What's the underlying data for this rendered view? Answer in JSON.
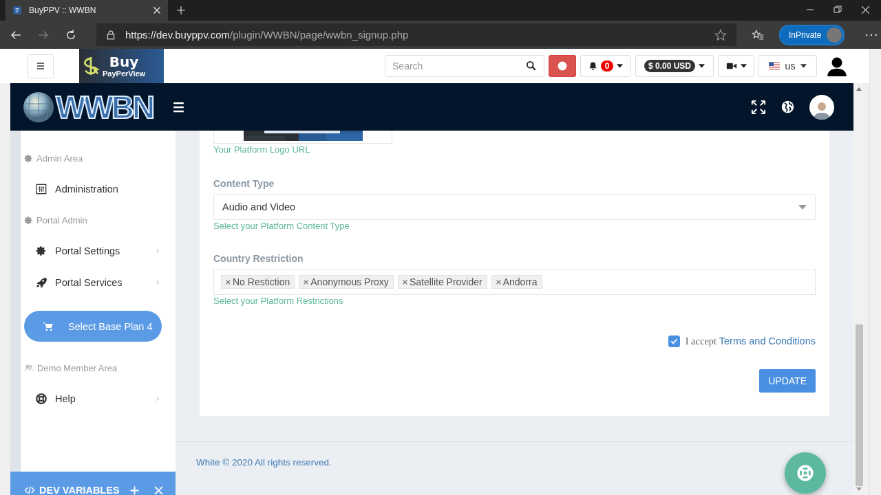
{
  "browser": {
    "tab_title": "BuyPPV :: WWBN",
    "url_host": "https://dev.buyppv.com",
    "url_path": "/plugin/WWBN/page/wwbn_signup.php",
    "profile_label": "InPrivate"
  },
  "header": {
    "logo_lines": [
      "Buy",
      "PayPerView"
    ],
    "search": {
      "placeholder": "Search"
    },
    "notification_count": "0",
    "balance": "$ 0.00 USD",
    "language": "us"
  },
  "navbar": {
    "logo": "WWBN"
  },
  "sidebar": {
    "items": [
      {
        "kind": "section",
        "label": "Admin Area"
      },
      {
        "kind": "link",
        "label": "Administration",
        "submenu": false
      },
      {
        "kind": "section",
        "label": "Portal Admin"
      },
      {
        "kind": "link",
        "label": "Portal Settings",
        "submenu": true
      },
      {
        "kind": "link",
        "label": "Portal Services",
        "submenu": true
      },
      {
        "kind": "button",
        "label": "Select Base Plan 4"
      },
      {
        "kind": "section",
        "label": "Demo Member Area"
      },
      {
        "kind": "link",
        "label": "Help",
        "submenu": true
      }
    ]
  },
  "form": {
    "logo_hint": "Your Platform Logo URL",
    "content_type": {
      "label": "Content Type",
      "value": "Audio and Video",
      "hint": "Select your Platform Content Type"
    },
    "country_restriction": {
      "label": "Country Restriction",
      "tags": [
        "No Restiction",
        "Anonymous Proxy",
        "Satellite Provider",
        "Andorra"
      ],
      "hint": "Select your Platform Restrictions"
    },
    "terms": {
      "checked": true,
      "text": "I accept",
      "link": "Terms and Conditions"
    },
    "submit": "UPDATE"
  },
  "footer": "White © 2020 All rights reserved.",
  "dev_panel": {
    "title": "DEV VARIABLES"
  }
}
